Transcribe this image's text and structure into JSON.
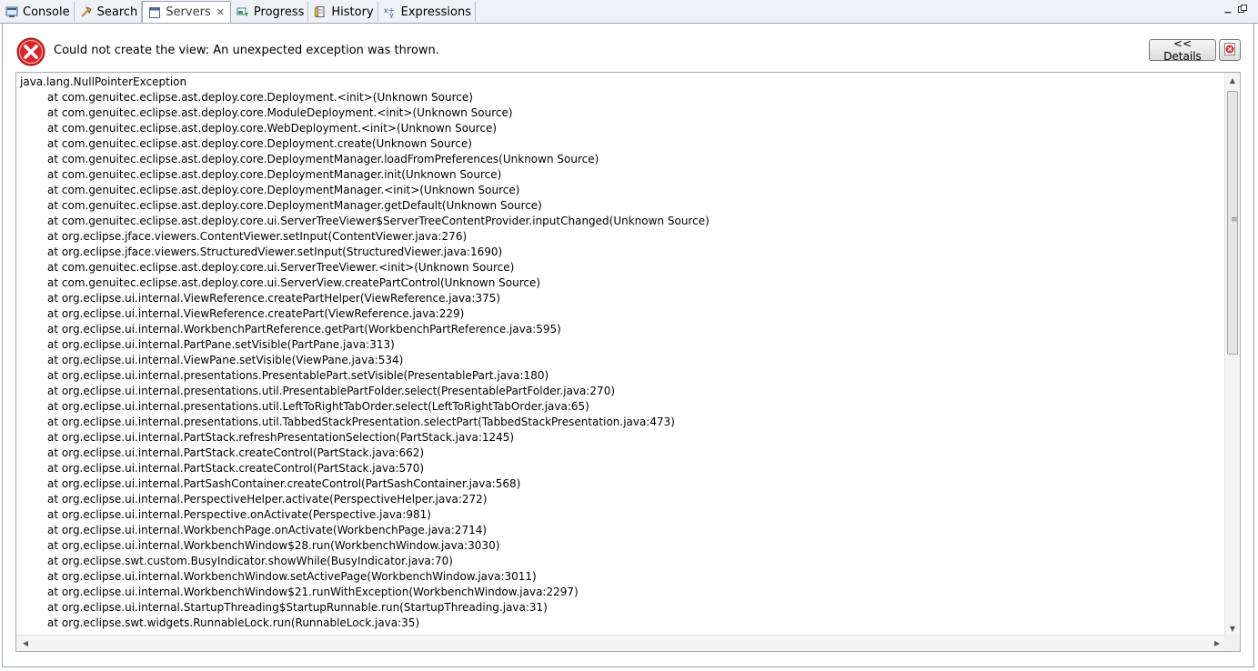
{
  "tabs": [
    {
      "label": "Console",
      "icon": "console-icon"
    },
    {
      "label": "Search",
      "icon": "search-icon"
    },
    {
      "label": "Servers",
      "icon": "servers-icon",
      "active": true
    },
    {
      "label": "Progress",
      "icon": "progress-icon"
    },
    {
      "label": "History",
      "icon": "history-icon"
    },
    {
      "label": "Expressions",
      "icon": "expressions-icon"
    }
  ],
  "error": {
    "message": "Could not create the view: An unexpected exception was thrown.",
    "details_label": "<< Details"
  },
  "colors": {
    "error_red": "#d9262a",
    "tab_bar_bg": "#eef1f6",
    "border": "#9aa4b3"
  },
  "trace": [
    "java.lang.NullPointerException",
    "at com.genuitec.eclipse.ast.deploy.core.Deployment.<init>(Unknown Source)",
    "at com.genuitec.eclipse.ast.deploy.core.ModuleDeployment.<init>(Unknown Source)",
    "at com.genuitec.eclipse.ast.deploy.core.WebDeployment.<init>(Unknown Source)",
    "at com.genuitec.eclipse.ast.deploy.core.Deployment.create(Unknown Source)",
    "at com.genuitec.eclipse.ast.deploy.core.DeploymentManager.loadFromPreferences(Unknown Source)",
    "at com.genuitec.eclipse.ast.deploy.core.DeploymentManager.init(Unknown Source)",
    "at com.genuitec.eclipse.ast.deploy.core.DeploymentManager.<init>(Unknown Source)",
    "at com.genuitec.eclipse.ast.deploy.core.DeploymentManager.getDefault(Unknown Source)",
    "at com.genuitec.eclipse.ast.deploy.core.ui.ServerTreeViewer$ServerTreeContentProvider.inputChanged(Unknown Source)",
    "at org.eclipse.jface.viewers.ContentViewer.setInput(ContentViewer.java:276)",
    "at org.eclipse.jface.viewers.StructuredViewer.setInput(StructuredViewer.java:1690)",
    "at com.genuitec.eclipse.ast.deploy.core.ui.ServerTreeViewer.<init>(Unknown Source)",
    "at com.genuitec.eclipse.ast.deploy.core.ui.ServerView.createPartControl(Unknown Source)",
    "at org.eclipse.ui.internal.ViewReference.createPartHelper(ViewReference.java:375)",
    "at org.eclipse.ui.internal.ViewReference.createPart(ViewReference.java:229)",
    "at org.eclipse.ui.internal.WorkbenchPartReference.getPart(WorkbenchPartReference.java:595)",
    "at org.eclipse.ui.internal.PartPane.setVisible(PartPane.java:313)",
    "at org.eclipse.ui.internal.ViewPane.setVisible(ViewPane.java:534)",
    "at org.eclipse.ui.internal.presentations.PresentablePart.setVisible(PresentablePart.java:180)",
    "at org.eclipse.ui.internal.presentations.util.PresentablePartFolder.select(PresentablePartFolder.java:270)",
    "at org.eclipse.ui.internal.presentations.util.LeftToRightTabOrder.select(LeftToRightTabOrder.java:65)",
    "at org.eclipse.ui.internal.presentations.util.TabbedStackPresentation.selectPart(TabbedStackPresentation.java:473)",
    "at org.eclipse.ui.internal.PartStack.refreshPresentationSelection(PartStack.java:1245)",
    "at org.eclipse.ui.internal.PartStack.createControl(PartStack.java:662)",
    "at org.eclipse.ui.internal.PartStack.createControl(PartStack.java:570)",
    "at org.eclipse.ui.internal.PartSashContainer.createControl(PartSashContainer.java:568)",
    "at org.eclipse.ui.internal.PerspectiveHelper.activate(PerspectiveHelper.java:272)",
    "at org.eclipse.ui.internal.Perspective.onActivate(Perspective.java:981)",
    "at org.eclipse.ui.internal.WorkbenchPage.onActivate(WorkbenchPage.java:2714)",
    "at org.eclipse.ui.internal.WorkbenchWindow$28.run(WorkbenchWindow.java:3030)",
    "at org.eclipse.swt.custom.BusyIndicator.showWhile(BusyIndicator.java:70)",
    "at org.eclipse.ui.internal.WorkbenchWindow.setActivePage(WorkbenchWindow.java:3011)",
    "at org.eclipse.ui.internal.WorkbenchWindow$21.runWithException(WorkbenchWindow.java:2297)",
    "at org.eclipse.ui.internal.StartupThreading$StartupRunnable.run(StartupThreading.java:31)",
    "at org.eclipse.swt.widgets.RunnableLock.run(RunnableLock.java:35)"
  ]
}
